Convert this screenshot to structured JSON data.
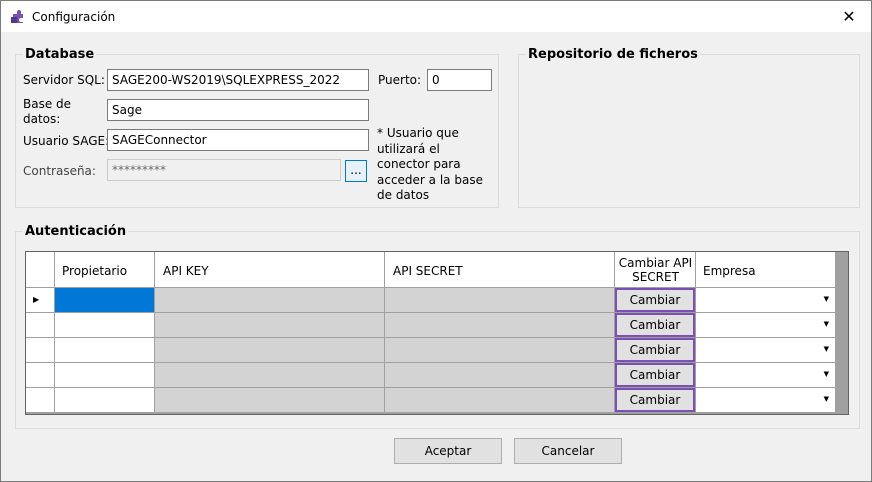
{
  "window": {
    "title": "Configuración",
    "close_glyph": "✕",
    "icon": "puzzle-icon"
  },
  "database": {
    "title": "Database",
    "server_label": "Servidor SQL:",
    "server_value": "SAGE200-WS2019\\SQLEXPRESS_2022",
    "port_label": "Puerto:",
    "port_value": "0",
    "db_label": "Base de datos:",
    "db_value": "Sage",
    "user_label": "Usuario SAGE:",
    "user_value": "SAGEConnector",
    "pass_label": "Contraseña:",
    "pass_value": "*********",
    "browse_label": "...",
    "note": "* Usuario que utilizará el conector para acceder a la base de datos"
  },
  "repository": {
    "title": "Repositorio de ficheros"
  },
  "auth": {
    "title": "Autenticación",
    "columns": [
      "Propietario",
      "API KEY",
      "API SECRET",
      "Cambiar API SECRET",
      "Empresa"
    ],
    "change_label": "Cambiar",
    "rows": [
      {
        "owner": "",
        "api_key": "",
        "api_secret": "",
        "company": ""
      },
      {
        "owner": "",
        "api_key": "",
        "api_secret": "",
        "company": ""
      },
      {
        "owner": "",
        "api_key": "",
        "api_secret": "",
        "company": ""
      },
      {
        "owner": "",
        "api_key": "",
        "api_secret": "",
        "company": ""
      },
      {
        "owner": "",
        "api_key": "",
        "api_secret": "",
        "company": ""
      }
    ]
  },
  "buttons": {
    "accept": "Aceptar",
    "cancel": "Cancelar"
  },
  "colors": {
    "selected_cell": "#0078d7",
    "readonly_cell": "#d3d3d3",
    "change_border": "#7b4fb4"
  }
}
